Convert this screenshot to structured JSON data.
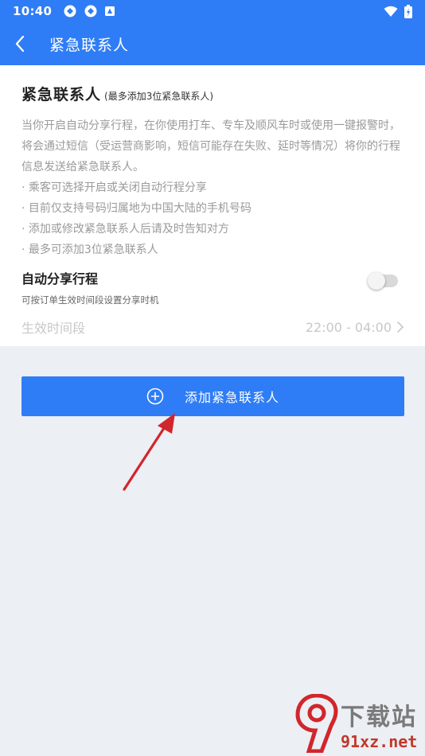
{
  "status_bar": {
    "time": "10:40",
    "icons": [
      "sync-icon",
      "sync-icon",
      "notification-icon"
    ],
    "right_icons": [
      "wifi-icon",
      "battery-charging-icon"
    ]
  },
  "app_bar": {
    "title": "紧急联系人",
    "back_icon": "chevron-left-icon"
  },
  "card": {
    "title": "紧急联系人",
    "note": "(最多添加3位紧急联系人)",
    "description": "当你开启自动分享行程，在你使用打车、专车及顺风车时或使用一键报警时，将会通过短信（受运营商影响，短信可能存在失败、延时等情况）将你的行程信息发送给紧急联系人。",
    "bullets": [
      "· 乘客可选择开启或关闭自动行程分享",
      "· 目前仅支持号码归属地为中国大陆的手机号码",
      "· 添加或修改紧急联系人后请及时告知对方",
      "· 最多可添加3位紧急联系人"
    ],
    "auto_share": {
      "title": "自动分享行程",
      "subtitle": "可按订单生效时间段设置分享时机",
      "enabled": false
    },
    "period": {
      "label": "生效时间段",
      "value": "22:00 - 04:00"
    }
  },
  "add_button": {
    "label": "添加紧急联系人",
    "icon": "plus-circle-icon"
  },
  "watermark": {
    "line1": "下载站",
    "line2": "91xz.net"
  },
  "colors": {
    "primary": "#2f7df6",
    "background": "#eceff4",
    "annotation_arrow": "#d0262c"
  }
}
